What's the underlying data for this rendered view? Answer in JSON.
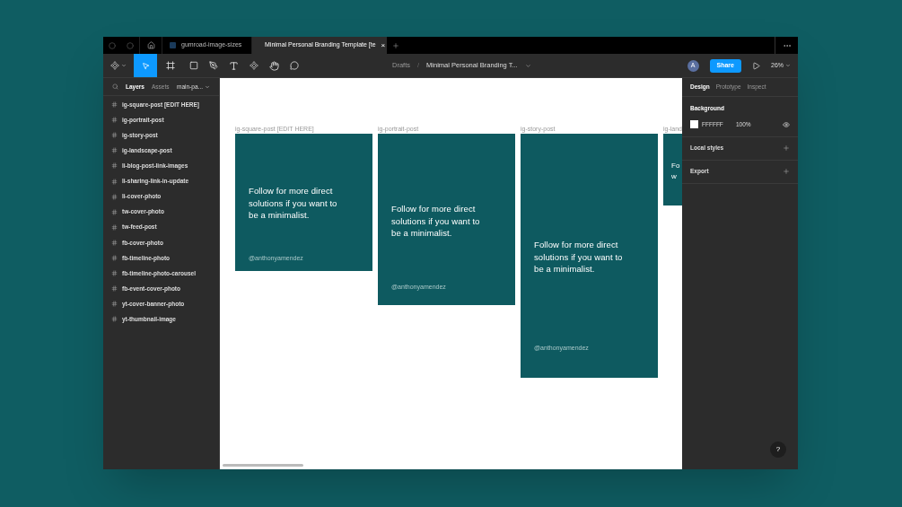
{
  "tabs": [
    {
      "label": "gumroad-image-sizes",
      "selected": false
    },
    {
      "label": "Minimal Personal Branding Template [te",
      "selected": true,
      "close": "×"
    }
  ],
  "toolbar": {
    "breadcrumb_root": "Drafts",
    "separator": "/",
    "file_name": "Minimal Personal Branding T...",
    "avatar": "A",
    "share": "Share",
    "zoom": "26%"
  },
  "left_panel": {
    "tabs": [
      {
        "label": "Layers",
        "selected": true
      },
      {
        "label": "Assets",
        "selected": false
      }
    ],
    "page": "main-pa...",
    "layers": [
      "ig-square-post [EDIT HERE]",
      "ig-portrait-post",
      "ig-story-post",
      "ig-landscape-post",
      "li-blog-post-link-images",
      "li-sharing-link-in-update",
      "li-cover-photo",
      "tw-cover-photo",
      "tw-feed-post",
      "fb-cover-photo",
      "fb-timeline-photo",
      "fb-timeline-photo-carousel",
      "fb-event-cover-photo",
      "yt-cover-banner-photo",
      "yt-thumbnail-image"
    ]
  },
  "canvas": {
    "frames": [
      {
        "label": "ig-square-post [EDIT HERE]",
        "kind": "square",
        "quote": [
          "Follow for more direct",
          "solutions if you want to",
          "be a minimalist."
        ],
        "handle": "@anthonyamendez"
      },
      {
        "label": "ig-portrait-post",
        "kind": "portrait",
        "quote": [
          "Follow for more direct",
          "solutions if you want to",
          "be a minimalist."
        ],
        "handle": "@anthonyamendez"
      },
      {
        "label": "ig-story-post",
        "kind": "story",
        "quote": [
          "Follow for more direct",
          "solutions if you want to",
          "be a minimalist."
        ],
        "handle": "@anthonyamendez"
      },
      {
        "label": "ig-land",
        "kind": "landscape",
        "quote": [
          "Fo",
          "w"
        ]
      }
    ]
  },
  "right_panel": {
    "tabs": [
      {
        "label": "Design",
        "selected": true
      },
      {
        "label": "Prototype",
        "selected": false
      },
      {
        "label": "Inspect",
        "selected": false
      }
    ],
    "background_title": "Background",
    "background_hex": "FFFFFF",
    "background_opacity": "100%",
    "sections": [
      "Local styles",
      "Export"
    ]
  },
  "help": "?"
}
